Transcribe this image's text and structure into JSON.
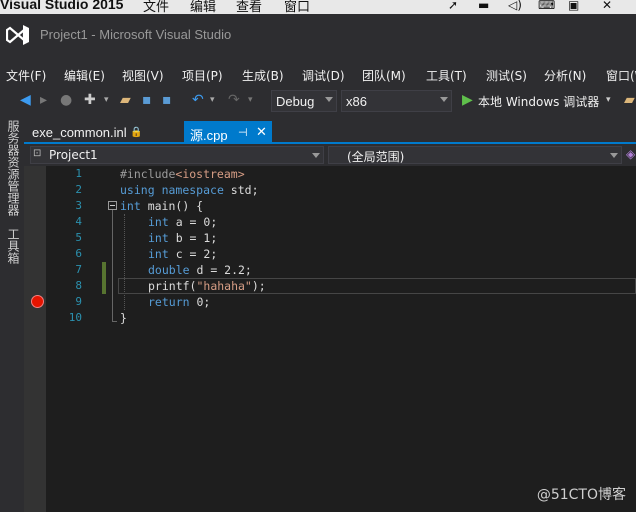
{
  "mac_menubar": {
    "app_name": "Visual Studio 2015",
    "menus": [
      "文件",
      "编辑",
      "查看",
      "窗口"
    ],
    "status_icons": [
      "cursor-icon",
      "chat-icon",
      "volume-icon",
      "keyboard-icon",
      "box-icon",
      "close-icon"
    ]
  },
  "window": {
    "title": "Project1 - Microsoft Visual Studio"
  },
  "menubar": {
    "items": [
      "文件(F)",
      "编辑(E)",
      "视图(V)",
      "项目(P)",
      "生成(B)",
      "调试(D)",
      "团队(M)",
      "工具(T)",
      "测试(S)",
      "分析(N)",
      "窗口(W)"
    ]
  },
  "toolbar": {
    "config": "Debug",
    "platform": "x86",
    "run_label": "本地 Windows 调试器"
  },
  "side_panels": [
    "服务器资源管理器",
    "工具箱"
  ],
  "tabs": [
    {
      "label": "exe_common.inl",
      "active": false
    },
    {
      "label": "源.cpp",
      "active": true
    }
  ],
  "navbar": {
    "project": "Project1",
    "scope": "(全局范围)"
  },
  "editor": {
    "line_numbers": [
      "1",
      "2",
      "3",
      "4",
      "5",
      "6",
      "7",
      "8",
      "9",
      "10"
    ],
    "lines": {
      "l1_pp": "#include",
      "l1_hdr": "<iostream>",
      "l2_kw1": "using",
      "l2_kw2": "namespace",
      "l2_rest": " std;",
      "l3_kw": "int",
      "l3_rest": " main() {",
      "l4_kw": "int",
      "l4_rest": " a = 0;",
      "l5_kw": "int",
      "l5_rest": " b = 1;",
      "l6_kw": "int",
      "l6_rest": " c = 2;",
      "l7_kw": "double",
      "l7_rest": " d = 2.2;",
      "l8_fn": "printf(",
      "l8_str": "\"hahaha\"",
      "l8_end": ");",
      "l9_kw": "return",
      "l9_rest": " 0;",
      "l10": "}"
    }
  },
  "watermark": "@51CTO博客"
}
